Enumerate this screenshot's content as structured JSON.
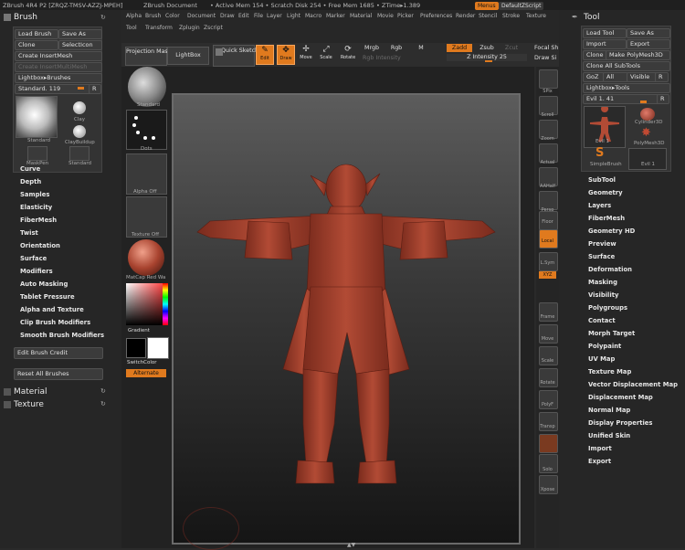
{
  "titlebar": {
    "app": "ZBrush 4R4 P2 [ZRQZ-TMSV-AZZJ-MPEH]",
    "doc": "ZBrush Document",
    "stats": "• Active Mem 154 • Scratch Disk 254 • Free Mem 1685 • ZTime▸1.389",
    "menus_btn": "Menus",
    "script_btn": "DefaultZScript"
  },
  "top_menus_row1": [
    "Alpha",
    "Brush",
    "Color",
    "Document",
    "Draw",
    "Edit",
    "File",
    "Layer",
    "Light",
    "Macro",
    "Marker",
    "Material",
    "Movie",
    "Picker",
    "Preferences",
    "Render",
    "Stencil",
    "Stroke",
    "Texture"
  ],
  "top_menus_row2": [
    "Tool",
    "Transform",
    "Zplugin",
    "Zscript"
  ],
  "toolbar": {
    "projection_master": "Projection Master",
    "lightbox": "LightBox",
    "quick_sketch": "Quick Sketch",
    "edit": "Edit",
    "draw": "Draw",
    "move": "Move",
    "scale": "Scale",
    "rotate": "Rotate",
    "mrgb": "Mrgb",
    "rgb": "Rgb",
    "m": "M",
    "rgb_intensity": "Rgb Intensity",
    "zadd": "Zadd",
    "zsub": "Zsub",
    "zcut": "Zcut",
    "z_intensity": "Z Intensity 25",
    "focal_shift": "Focal Sh",
    "draw_size": "Draw Si"
  },
  "brush_palette": {
    "title": "Brush",
    "load": "Load Brush",
    "save": "Save As",
    "clone": "Clone",
    "select_icon": "SelectIcon",
    "create_insert": "Create InsertMesh",
    "create_insert_multi": "Create InsertMultiMesh",
    "lightbox_brushes": "Lightbox▸Brushes",
    "standard": "Standard. 119",
    "r": "R",
    "thumbs": [
      "Standard",
      "Clay",
      "ClayBuildup",
      "MaskPen",
      "Standard"
    ],
    "sections": [
      "Curve",
      "Depth",
      "Samples",
      "Elasticity",
      "FiberMesh",
      "Twist",
      "Orientation",
      "Surface",
      "Modifiers",
      "Auto Masking",
      "Tablet Pressure",
      "Alpha and Texture",
      "Clip Brush Modifiers",
      "Smooth Brush Modifiers"
    ],
    "edit_credit": "Edit Brush Credit",
    "reset_all": "Reset All Brushes",
    "material": "Material",
    "texture": "Texture"
  },
  "shelf": {
    "standard": "Standard",
    "dots": "Dots",
    "alpha_off": "Alpha Off",
    "texture_off": "Texture Off",
    "matcap": "MatCap Red Wa",
    "gradient": "Gradient",
    "switch_color": "SwitchColor",
    "alternate": "Alternate"
  },
  "right_shelf": [
    "SPix",
    "Scroll",
    "Zoom",
    "Actual",
    "AAHalf",
    "Persp",
    "Floor",
    "Local",
    "L.Sym",
    "XYZ",
    "Frame",
    "Move",
    "Scale",
    "Rotate",
    "PolyF",
    "Transp",
    "Solo",
    "Xpose"
  ],
  "tool_palette": {
    "title": "Tool",
    "load": "Load Tool",
    "save": "Save As",
    "import": "Import",
    "export": "Export",
    "clone": "Clone",
    "make_polymesh": "Make PolyMesh3D",
    "clone_all": "Clone All SubTools",
    "goz": "GoZ",
    "all": "All",
    "visible": "Visible",
    "r": "R",
    "lightbox_tools": "Lightbox▸Tools",
    "current": "Evil 1. 41",
    "r2": "R",
    "thumbs": [
      "Evil 1",
      "Cylinder3D",
      "PolyMesh3D",
      "SimpleBrush",
      "Evil 1"
    ],
    "sections": [
      "SubTool",
      "Geometry",
      "Layers",
      "FiberMesh",
      "Geometry HD",
      "Preview",
      "Surface",
      "Deformation",
      "Masking",
      "Visibility",
      "Polygroups",
      "Contact",
      "Morph Target",
      "Polypaint",
      "UV Map",
      "Texture Map",
      "Vector Displacement Map",
      "Displacement Map",
      "Normal Map",
      "Display Properties",
      "Unified Skin",
      "Import",
      "Export"
    ]
  },
  "colors": {
    "accent": "#e07a1e",
    "model": "#a8432f"
  }
}
